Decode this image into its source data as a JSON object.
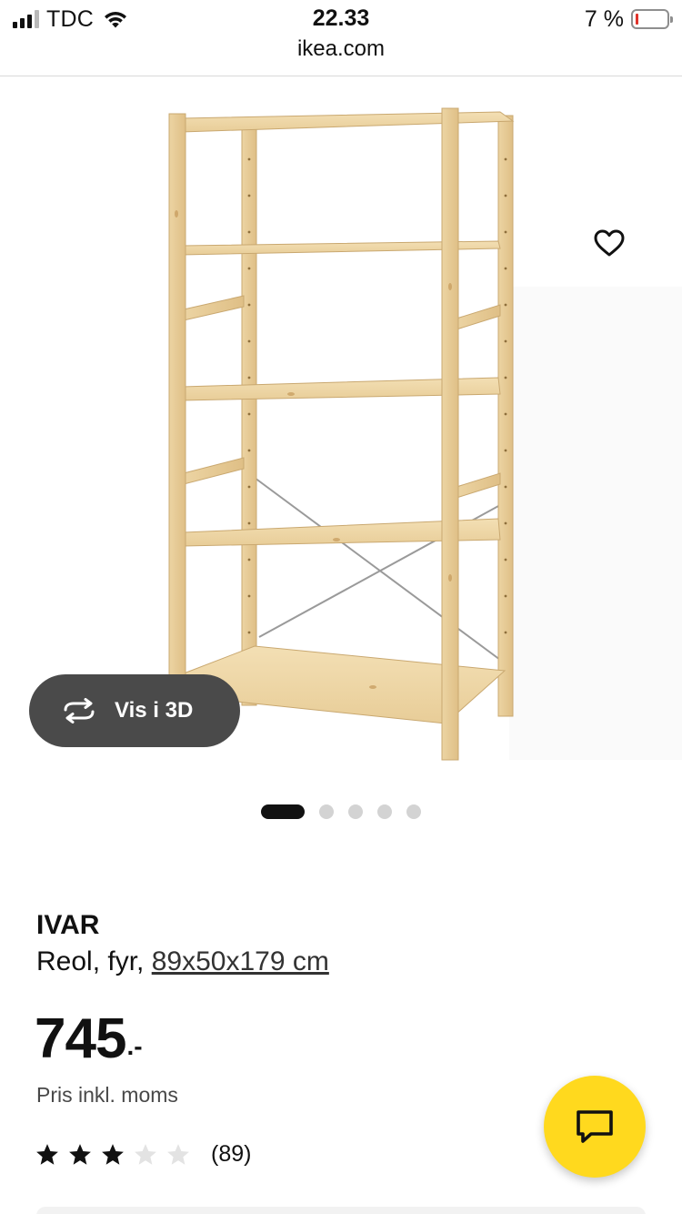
{
  "status_bar": {
    "carrier": "TDC",
    "time": "22.33",
    "battery_percent": "7 %",
    "battery_level": 0.07,
    "signal_bars_on": 3,
    "signal_bars_total": 4,
    "battery_low_color": "#e0332a"
  },
  "browser": {
    "url": "ikea.com"
  },
  "gallery": {
    "image_count": 5,
    "active_index": 0,
    "view_3d_label": "Vis i 3D",
    "view_3d_icon": "rotate-3d-icon",
    "favorite_icon": "heart-outline-icon"
  },
  "product": {
    "name": "IVAR",
    "description": "Reol, fyr,",
    "dimensions": "89x50x179 cm",
    "price": "745",
    "price_suffix": ".-",
    "price_note": "Pris inkl. moms",
    "rating": 3,
    "rating_max": 5,
    "review_count": "(89)"
  },
  "chat": {
    "icon": "chat-bubble-icon",
    "color": "#ffd91e"
  }
}
